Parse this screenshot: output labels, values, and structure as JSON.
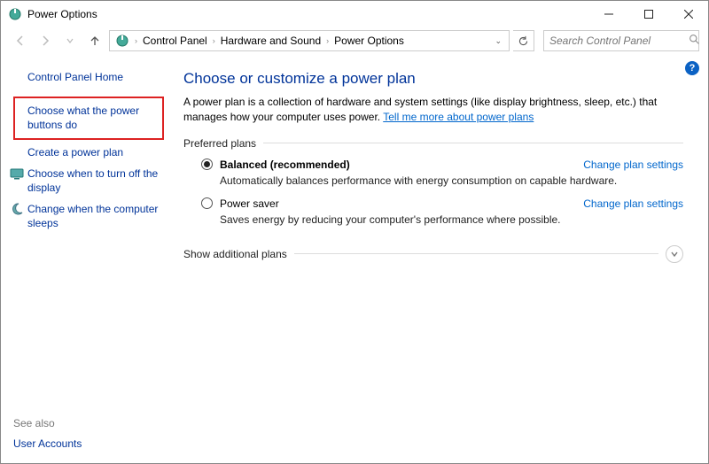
{
  "window": {
    "title": "Power Options"
  },
  "breadcrumb": {
    "items": [
      "Control Panel",
      "Hardware and Sound",
      "Power Options"
    ]
  },
  "search": {
    "placeholder": "Search Control Panel"
  },
  "sidebar": {
    "home": "Control Panel Home",
    "links": {
      "choose_buttons": "Choose what the power buttons do",
      "create_plan": "Create a power plan",
      "turn_off_display": "Choose when to turn off the display",
      "change_sleep": "Change when the computer sleeps"
    },
    "see_also_label": "See also",
    "see_also_links": {
      "user_accounts": "User Accounts"
    }
  },
  "main": {
    "heading": "Choose or customize a power plan",
    "desc_part1": "A power plan is a collection of hardware and system settings (like display brightness, sleep, etc.) that manages how your computer uses power. ",
    "desc_link": "Tell me more about power plans",
    "preferred_label": "Preferred plans",
    "plans": {
      "balanced": {
        "name": "Balanced (recommended)",
        "desc": "Automatically balances performance with energy consumption on capable hardware.",
        "change": "Change plan settings"
      },
      "power_saver": {
        "name": "Power saver",
        "desc": "Saves energy by reducing your computer's performance where possible.",
        "change": "Change plan settings"
      }
    },
    "show_additional": "Show additional plans"
  }
}
